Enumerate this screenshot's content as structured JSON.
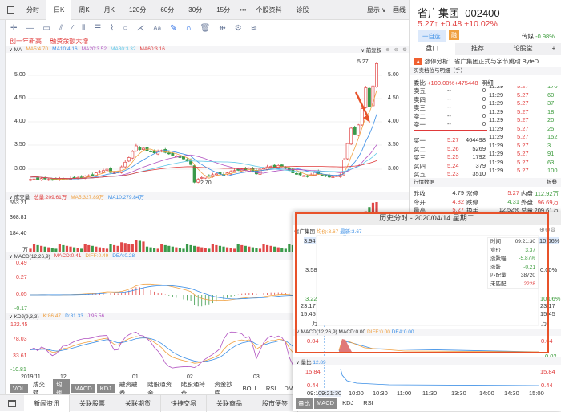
{
  "toolbar": {
    "tabs": [
      "分时",
      "日K",
      "周K",
      "月K",
      "120分",
      "60分",
      "30分",
      "15分",
      "•••",
      "个股资料",
      "诊股"
    ],
    "active": "日K",
    "display": "显示 ∨",
    "draw": "画线"
  },
  "highlights": [
    "创一年新高",
    "融资余额大增"
  ],
  "ma": {
    "label": "∨ MA",
    "ma5": "MA5:4.70",
    "ma10": "MA10:4.16",
    "ma20": "MA20:3.52",
    "ma30": "MA30:3.32",
    "ma60": "MA60:3.16",
    "adjust": "∨ 前复权"
  },
  "price_axis": [
    "5.00",
    "4.50",
    "4.00",
    "3.50",
    "3.00"
  ],
  "high_mark": "5.27",
  "low_mark": "2.70",
  "kline_closes": [
    2.78,
    2.79,
    2.78,
    2.8,
    2.79,
    2.78,
    2.77,
    2.78,
    2.79,
    2.8,
    2.79,
    2.8,
    2.81,
    2.82,
    2.83,
    2.85,
    2.86,
    2.88,
    2.92,
    2.95,
    2.97,
    3.0,
    2.93,
    2.92,
    2.95,
    3.05,
    3.15,
    3.25,
    3.38,
    3.5,
    3.42,
    3.45,
    3.4,
    3.38,
    3.35,
    3.38,
    3.4,
    3.36,
    3.33,
    3.3,
    3.28,
    3.25,
    3.22,
    3.18,
    3.1,
    2.72,
    2.78,
    2.82,
    2.85,
    2.86,
    2.88,
    2.9,
    2.9,
    2.88,
    2.92,
    2.95,
    2.97,
    2.98,
    3.0,
    2.98,
    3.02,
    2.95,
    2.9,
    3.0,
    3.02,
    3.05,
    3.06,
    3.04,
    3.08,
    3.06,
    3.02,
    2.98,
    2.92,
    2.9,
    2.88,
    2.86,
    2.84,
    2.88,
    2.95,
    2.9,
    2.87,
    2.85,
    2.83,
    2.84,
    2.86,
    2.88,
    3.2,
    3.55,
    3.88,
    3.75,
    3.95,
    4.3,
    4.75,
    4.35,
    4.79,
    5.27
  ],
  "volume": {
    "label": "∨ 成交量",
    "total": "总量:209.61万",
    "ma5": "MA5:327.89万",
    "ma10": "MA10:279.84万",
    "axis": [
      "553.21",
      "368.81",
      "184.40",
      "万"
    ]
  },
  "macd": {
    "label": "∨ MACD(12,26,9)",
    "macd": "MACD:0.41",
    "diff": "DIFF:0.49",
    "dea": "DEA:0.28",
    "axis": [
      "0.49",
      "0.27",
      "0.05",
      "-0.17"
    ]
  },
  "kdj": {
    "label": "∨ KDJ(9,3,3)",
    "k": "K:86.47",
    "d": "D:81.33",
    "j": "J:95.56",
    "axis": [
      "122.45",
      "78.03",
      "33.61",
      "-10.81"
    ]
  },
  "dates": [
    "2019/11",
    "12",
    "01",
    "02",
    "03"
  ],
  "indicator_tabs": [
    "VOL",
    "成交额",
    "均线",
    "MACD",
    "KDJ",
    "融资融券",
    "陆股通资金",
    "陆股通持仓",
    "资金抄底",
    "BOLL",
    "RSI",
    "DM"
  ],
  "bottom_tabs": [
    "新闻资讯",
    "关联股票",
    "关联期货",
    "快捷交易",
    "关联商品",
    "股市便签"
  ],
  "stock": {
    "name": "省广集团",
    "code": "002400",
    "price": "5.27↑",
    "change": "+0.48",
    "pct": "+10.02%",
    "watch": "一自选",
    "rz": "融",
    "sector": "传媒",
    "sector_pct": "-0.98%"
  },
  "right_tabs": [
    "盘口",
    "推荐",
    "论股堂",
    "+"
  ],
  "news": "涨停分析：省广集团正式与字节跳动 ByteD...",
  "orderbook": {
    "title": "买卖档位与明细（手）",
    "ratio_label": "委比",
    "ratio": "+100.00%+475448",
    "detail_label": "明细",
    "asks": [
      {
        "l": "卖五",
        "p": "--",
        "v": "0"
      },
      {
        "l": "卖四",
        "p": "--",
        "v": "0"
      },
      {
        "l": "卖三",
        "p": "--",
        "v": "0"
      },
      {
        "l": "卖二",
        "p": "--",
        "v": "0"
      },
      {
        "l": "卖一",
        "p": "--",
        "v": "0"
      }
    ],
    "bids": [
      {
        "l": "买一",
        "p": "5.27",
        "v": "464498"
      },
      {
        "l": "买二",
        "p": "5.26",
        "v": "5269"
      },
      {
        "l": "买三",
        "p": "5.25",
        "v": "1792"
      },
      {
        "l": "买四",
        "p": "5.24",
        "v": "379"
      },
      {
        "l": "买五",
        "p": "5.23",
        "v": "3510"
      }
    ],
    "details": [
      {
        "t": "11:29",
        "p": "5.27",
        "v": "170"
      },
      {
        "t": "11:29",
        "p": "5.27",
        "v": "60"
      },
      {
        "t": "11:29",
        "p": "5.27",
        "v": "37"
      },
      {
        "t": "11:29",
        "p": "5.27",
        "v": "18"
      },
      {
        "t": "11:29",
        "p": "5.27",
        "v": "20"
      },
      {
        "t": "11:29",
        "p": "5.27",
        "v": "25"
      },
      {
        "t": "11:29",
        "p": "5.27",
        "v": "152"
      },
      {
        "t": "11:29",
        "p": "5.27",
        "v": "3"
      },
      {
        "t": "11:29",
        "p": "5.27",
        "v": "91"
      },
      {
        "t": "11:29",
        "p": "5.27",
        "v": "63"
      },
      {
        "t": "11:29",
        "p": "5.27",
        "v": "100"
      }
    ]
  },
  "quote": {
    "title": "行情数据",
    "fold": "折叠",
    "rows": [
      [
        "昨收",
        "4.79",
        "涨停",
        "5.27",
        "内盘",
        "112.92万"
      ],
      [
        "今开",
        "4.82",
        "跌停",
        "4.31",
        "外盘",
        "96.69万"
      ],
      [
        "最高",
        "5.27",
        "换手",
        "12.52%",
        "总量",
        "209.61万"
      ]
    ]
  },
  "popup": {
    "title": "历史分时 - 2020/04/14 星期二",
    "name": "省广集团",
    "avg": "均价:3.67",
    "last": "最新:3.67",
    "axis_left": [
      "3.94",
      "3.58",
      "3.22",
      "23.17",
      "15.45",
      "万"
    ],
    "axis_right": [
      "10.06%",
      "0.00%",
      "10.06%",
      "23.17",
      "15.45",
      "万"
    ],
    "tooltip": [
      [
        "时间",
        "09:21:30"
      ],
      [
        "竞价",
        "3.37"
      ],
      [
        "涨跌幅",
        "-5.87%"
      ],
      [
        "涨跌",
        "-0.21"
      ],
      [
        "匹配量",
        "38720"
      ],
      [
        "未匹配",
        "2228"
      ]
    ],
    "macd": {
      "label": "∨ MACD(12,26,9)",
      "macd": "MACD:0.00",
      "diff": "DIFF:0.00",
      "dea": "DEA:0.00",
      "axis": [
        "0.04",
        "0.02"
      ]
    },
    "lb": {
      "label": "∨ 量比",
      "value": "12.89",
      "axis": [
        "15.84",
        "0.44"
      ]
    },
    "times": [
      "09:1",
      "09:21:30",
      "10:00",
      "10:30",
      "11:00",
      "11:30",
      "13:30",
      "14:00",
      "14:30",
      "15:00"
    ],
    "tabs": [
      "量比",
      "MACD",
      "KDJ",
      "RSI"
    ]
  }
}
